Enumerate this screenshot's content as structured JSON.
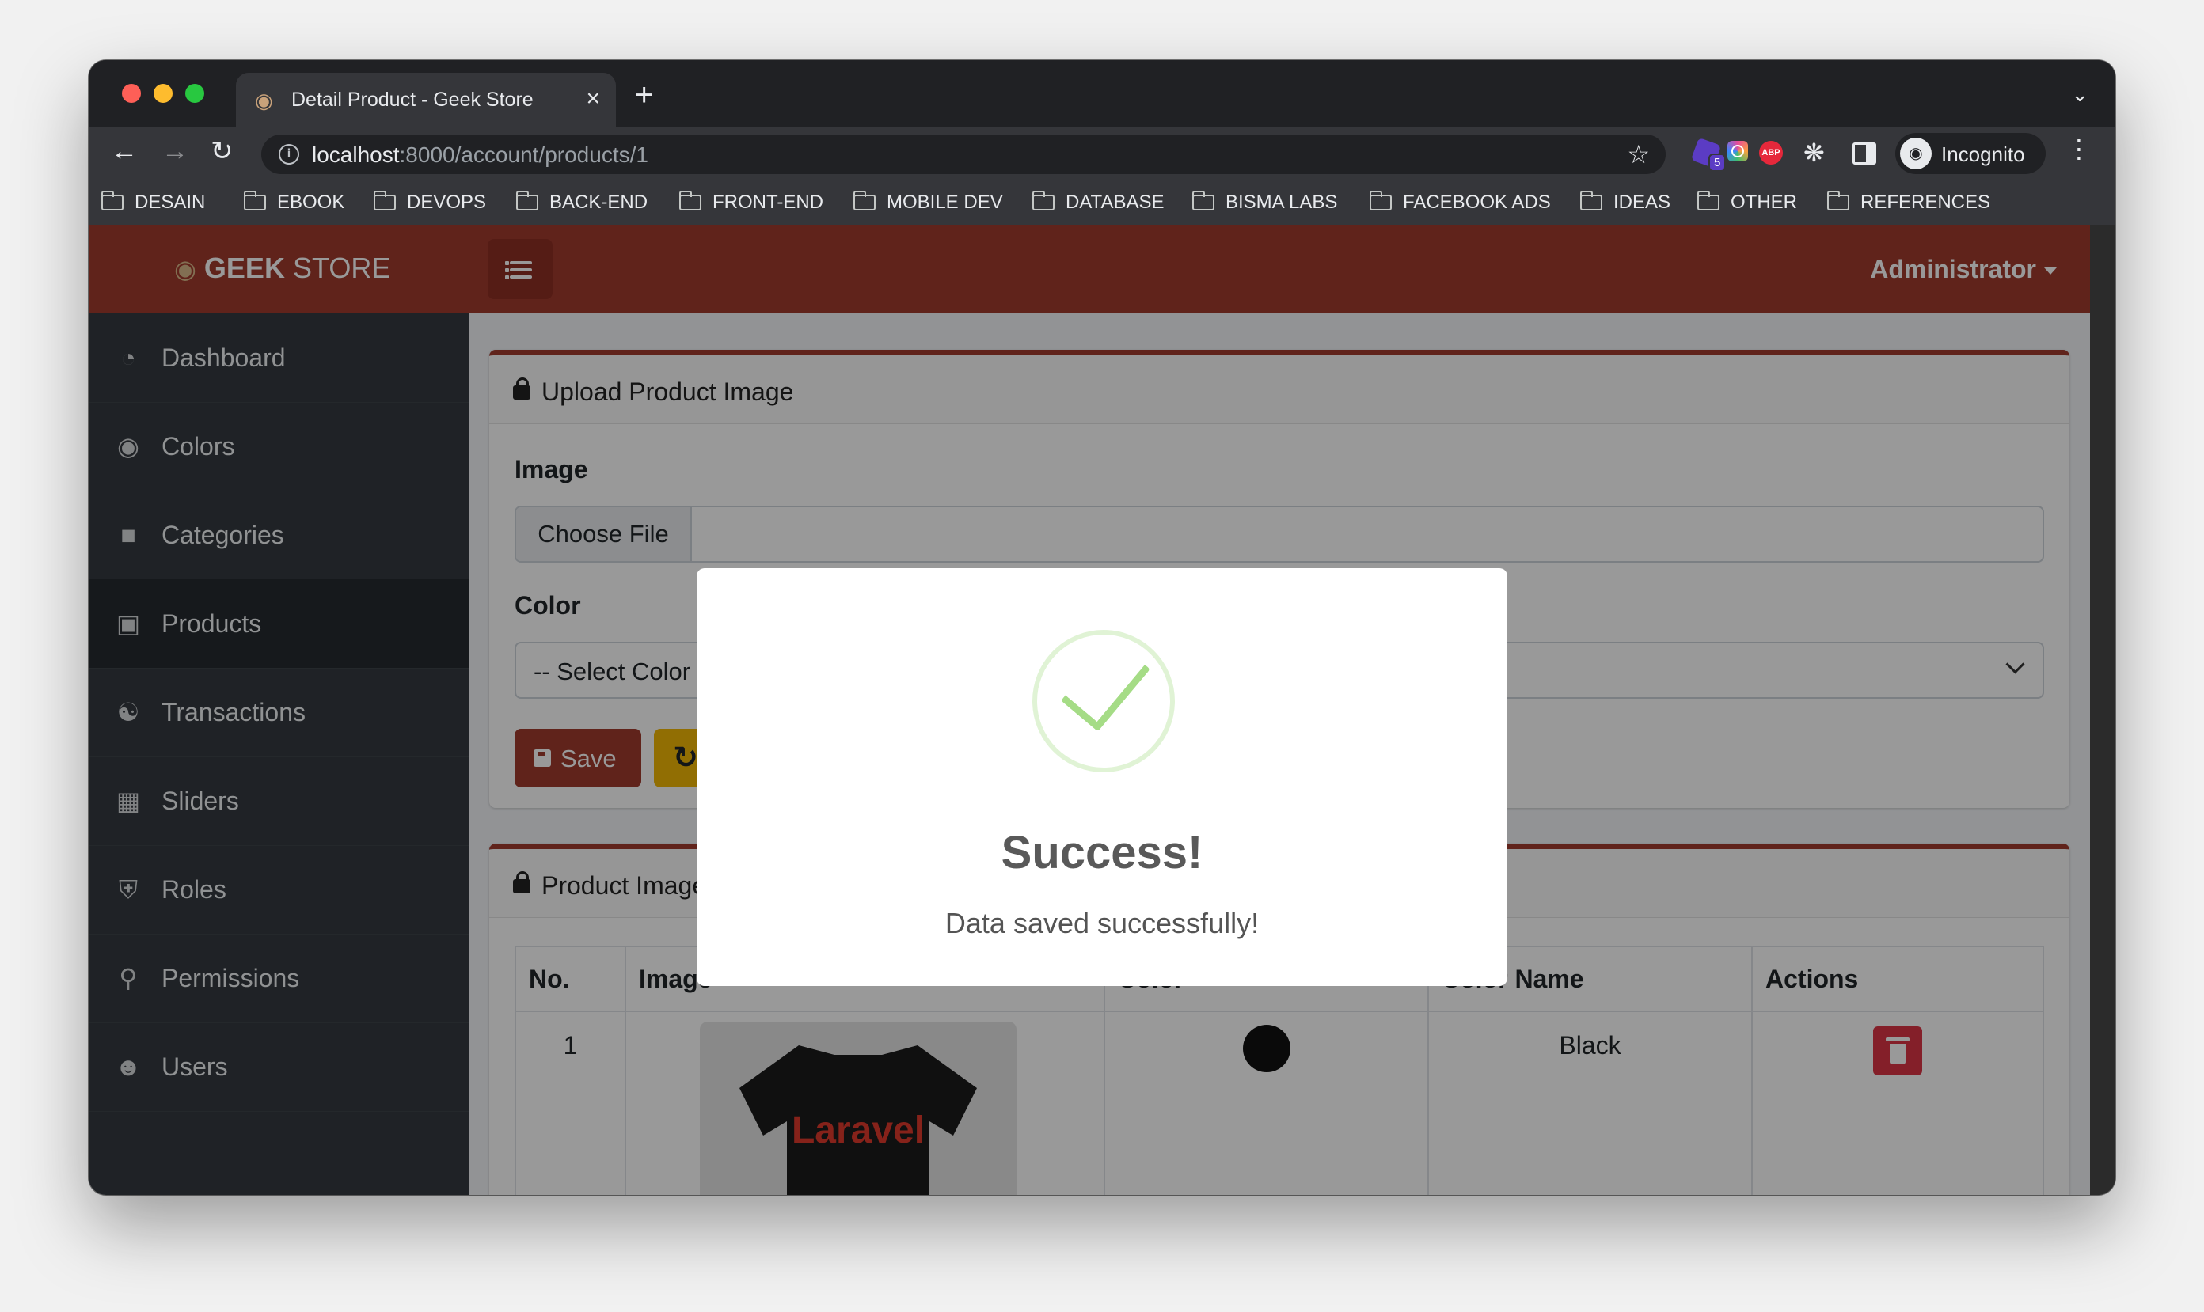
{
  "browser": {
    "tab_title": "Detail Product - Geek Store",
    "tab_close": "×",
    "new_tab": "+",
    "url_host": "localhost",
    "url_path": ":8000/account/products/1",
    "extension_badge": "5",
    "abp_label": "ABP",
    "profile_label": "Incognito",
    "bookmarks": [
      "DESAIN",
      "EBOOK",
      "DEVOPS",
      "BACK-END",
      "FRONT-END",
      "MOBILE DEV",
      "DATABASE",
      "BISMA LABS",
      "FACEBOOK ADS",
      "IDEAS",
      "OTHER",
      "REFERENCES"
    ]
  },
  "app": {
    "brand_strong": "GEEK",
    "brand_light": "STORE",
    "user_menu": "Administrator"
  },
  "sidebar": {
    "items": [
      {
        "label": "Dashboard",
        "icon": "tachometer-icon"
      },
      {
        "label": "Colors",
        "icon": "palette-icon"
      },
      {
        "label": "Categories",
        "icon": "folder-icon"
      },
      {
        "label": "Products",
        "icon": "shopping-bag-icon",
        "active": true
      },
      {
        "label": "Transactions",
        "icon": "cart-icon"
      },
      {
        "label": "Sliders",
        "icon": "images-icon"
      },
      {
        "label": "Roles",
        "icon": "shield-icon"
      },
      {
        "label": "Permissions",
        "icon": "key-icon"
      },
      {
        "label": "Users",
        "icon": "users-icon"
      }
    ]
  },
  "upload_card": {
    "title": "Upload Product Image",
    "image_label": "Image",
    "file_button": "Choose File",
    "color_label": "Color",
    "color_placeholder": "-- Select Color --",
    "save_label": "Save"
  },
  "images_card": {
    "title": "Product Images",
    "headers": [
      "No.",
      "Image",
      "Color",
      "Color Name",
      "Actions"
    ],
    "rows": [
      {
        "no": "1",
        "image_text": "Laravel",
        "color": "#111111",
        "color_name": "Black"
      }
    ]
  },
  "modal": {
    "title": "Success!",
    "text": "Data saved successfully!"
  },
  "colors": {
    "brand": "#a13b2e",
    "success": "#a5dc86",
    "danger": "#dc3545",
    "warning": "#f2b705",
    "sidebar": "#343a40"
  }
}
